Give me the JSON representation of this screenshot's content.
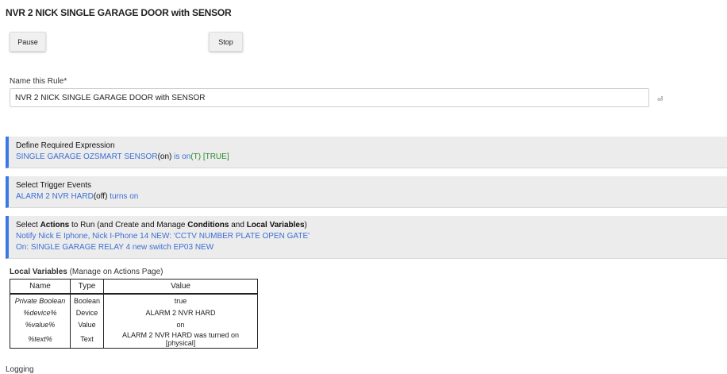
{
  "page": {
    "title": "NVR 2 NICK SINGLE GARAGE DOOR with SENSOR"
  },
  "controls": {
    "pause_label": "Pause",
    "stop_label": "Stop"
  },
  "name_field": {
    "label": "Name this Rule*",
    "value": "NVR 2 NICK SINGLE GARAGE DOOR with SENSOR"
  },
  "expression": {
    "title": "Define Required Expression",
    "device": "SINGLE GARAGE OZSMART SENSOR",
    "state": "(on)",
    "condition": " is on",
    "truth": "(T) [TRUE]"
  },
  "triggers": {
    "title": "Select Trigger Events",
    "device": "ALARM 2 NVR HARD",
    "state": "(off)",
    "event": " turns on"
  },
  "actions": {
    "title_parts": [
      "Select ",
      "Actions",
      " to Run (and Create and Manage ",
      "Conditions",
      " and ",
      "Local Variables",
      ")"
    ],
    "lines": [
      "Notify Nick E Iphone, Nick I-Phone 14 NEW: 'CCTV NUMBER PLATE OPEN GATE'",
      "On: SINGLE GARAGE RELAY 4 new switch EP03 NEW"
    ]
  },
  "local_vars": {
    "heading": "Local Variables",
    "note": " (Manage on Actions Page)",
    "columns": [
      "Name",
      "Type",
      "Value"
    ],
    "rows": [
      {
        "name": "Private Boolean",
        "type": "Boolean",
        "value": "true"
      },
      {
        "name": "%device%",
        "type": "Device",
        "value": "ALARM 2 NVR HARD"
      },
      {
        "name": "%value%",
        "type": "Value",
        "value": "on"
      },
      {
        "name": "%text%",
        "type": "Text",
        "value": "ALARM 2 NVR HARD was turned on [physical]"
      }
    ]
  },
  "logging": {
    "label": "Logging"
  },
  "colors": {
    "accent": "#3b78e7",
    "link": "#3b6fd4",
    "true_green": "#2a8a2a",
    "section_bg": "#ececec"
  }
}
